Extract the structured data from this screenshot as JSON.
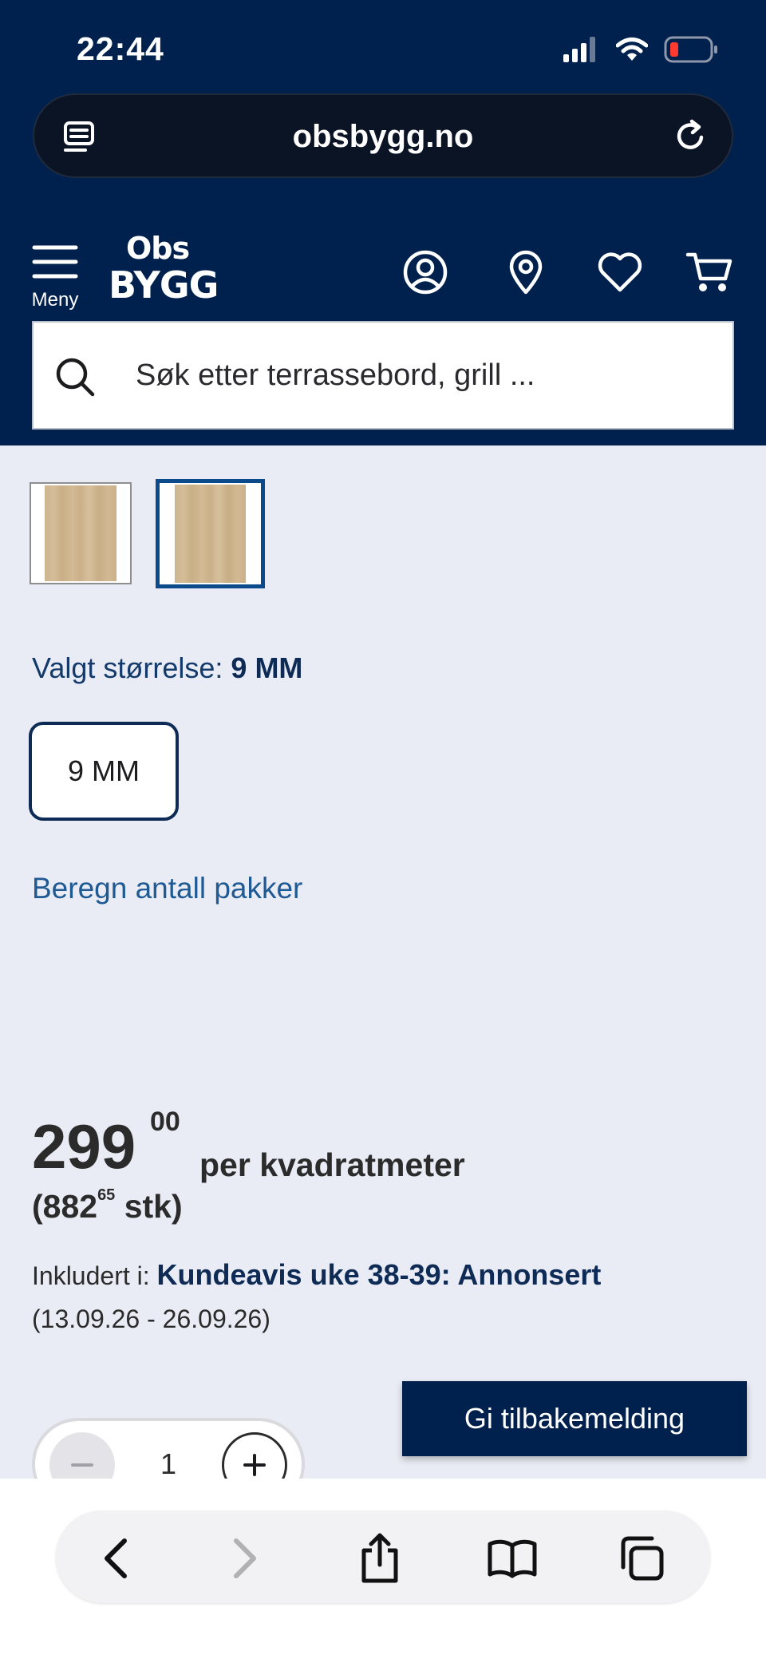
{
  "status_bar": {
    "time": "22:44"
  },
  "browser": {
    "url": "obsbygg.no"
  },
  "site_header": {
    "menu_label": "Meny",
    "logo_top": "Obs",
    "logo_bottom": "BYGG",
    "search_placeholder": "Søk etter terrassebord, grill ..."
  },
  "product": {
    "size_label_prefix": "Valgt størrelse:",
    "size_selected": "9 MM",
    "size_options": [
      "9 MM"
    ],
    "calc_link": "Beregn antall pakker",
    "price": {
      "integer": "299",
      "decimals": "00",
      "unit": "per kvadratmeter",
      "stk_open": "(882",
      "stk_decimals": "65",
      "stk_close": "stk)"
    },
    "campaign_prefix": "Inkludert i:",
    "campaign_link": "Kundeavis uke 38-39: Annonsert",
    "campaign_dates": "(13.09.26 - 26.09.26)",
    "quantity": "1",
    "thumbnail_selected_index": 1
  },
  "feedback_button": "Gi tilbakemelding",
  "colors": {
    "header_navy": "#00214e",
    "page_background": "#e9ecf4",
    "link_blue": "#1f5a94",
    "selected_border": "#0b4a8b"
  },
  "icons": {
    "status": [
      "signal-icon",
      "wifi-icon",
      "battery-low-icon"
    ],
    "url_bar": [
      "tabs-overview-icon",
      "reload-icon"
    ],
    "site_nav": [
      "hamburger-menu-icon",
      "account-icon",
      "location-pin-icon",
      "heart-icon",
      "cart-icon"
    ],
    "search": "search-icon",
    "toolbar": [
      "back-icon",
      "forward-icon",
      "share-icon",
      "bookmarks-icon",
      "tabs-icon"
    ]
  }
}
